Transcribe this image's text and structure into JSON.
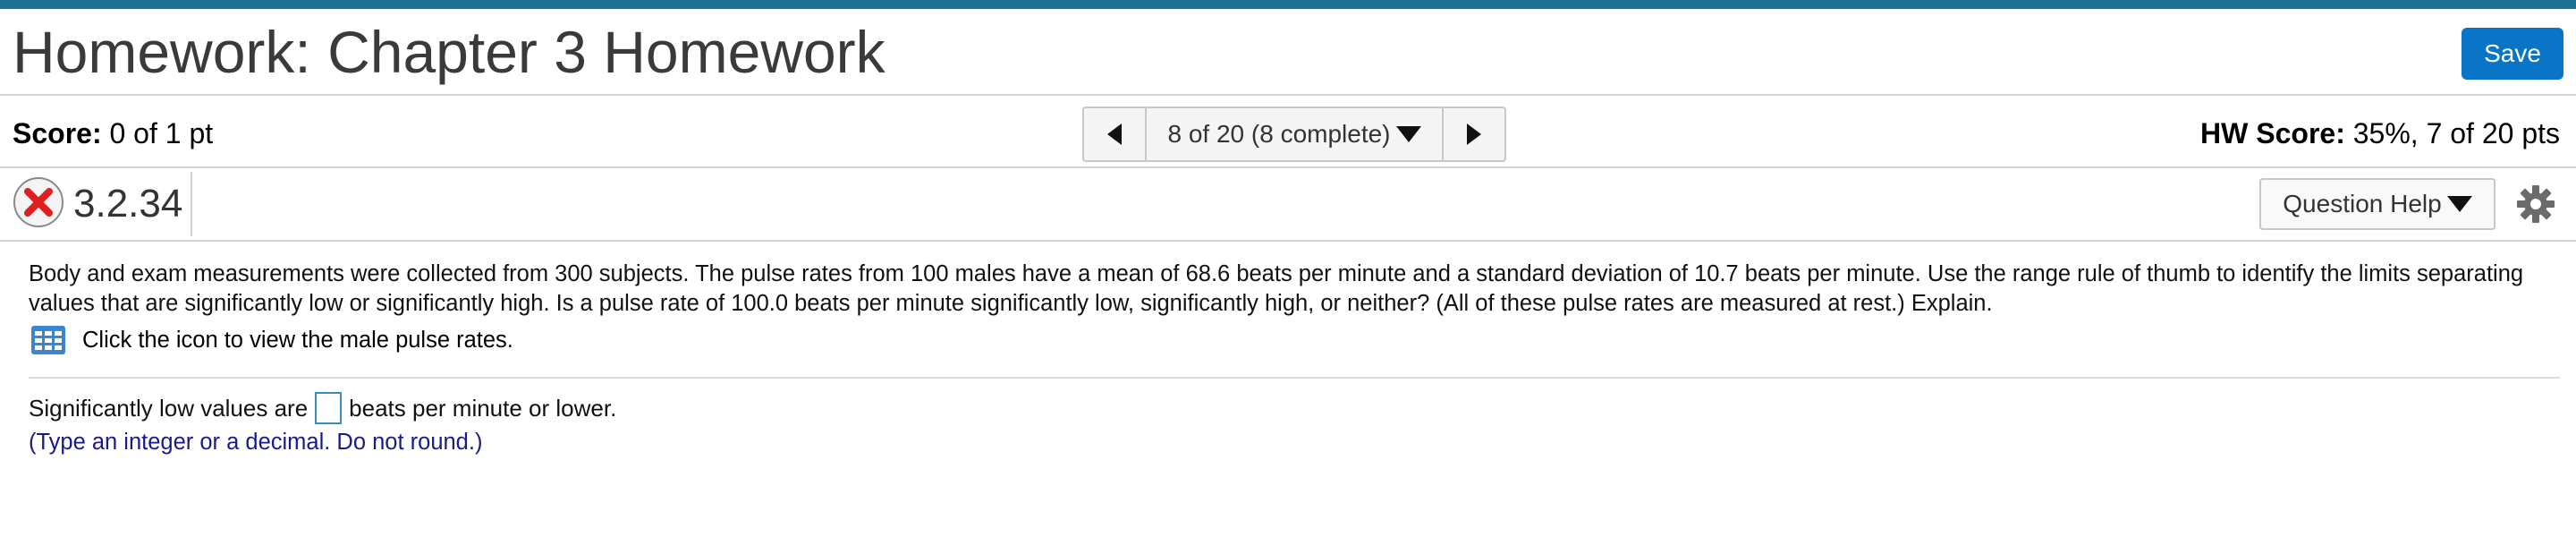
{
  "header": {
    "title": "Homework: Chapter 3 Homework",
    "save_label": "Save"
  },
  "score_bar": {
    "score_label": "Score:",
    "score_value": "0 of 1 pt",
    "nav_label": "8 of 20 (8 complete)",
    "hw_score_label": "HW Score:",
    "hw_score_value": "35%, 7 of 20 pts"
  },
  "question_bar": {
    "question_id": "3.2.34",
    "status_icon": "incorrect-x-icon",
    "help_label": "Question Help"
  },
  "question": {
    "text": "Body and exam measurements were collected from 300 subjects. The pulse rates from 100 males have a mean of 68.6 beats per minute and a standard deviation of 10.7 beats per minute. Use the range rule of thumb to identify the limits separating values that are significantly low or significantly high. Is a pulse rate of 100.0 beats per minute significantly low, significantly high, or neither? (All of these pulse rates are measured at rest.) Explain.",
    "table_link": "Click the icon to view the male pulse rates."
  },
  "answer": {
    "prefix": "Significantly low values are",
    "suffix": "beats per minute or lower.",
    "value": "",
    "hint": "(Type an integer or a decimal. Do not round.)"
  },
  "colors": {
    "accent": "#0a74c7",
    "topbar": "#1e6f94",
    "incorrect": "#e02020",
    "hint": "#1a1a8c"
  }
}
